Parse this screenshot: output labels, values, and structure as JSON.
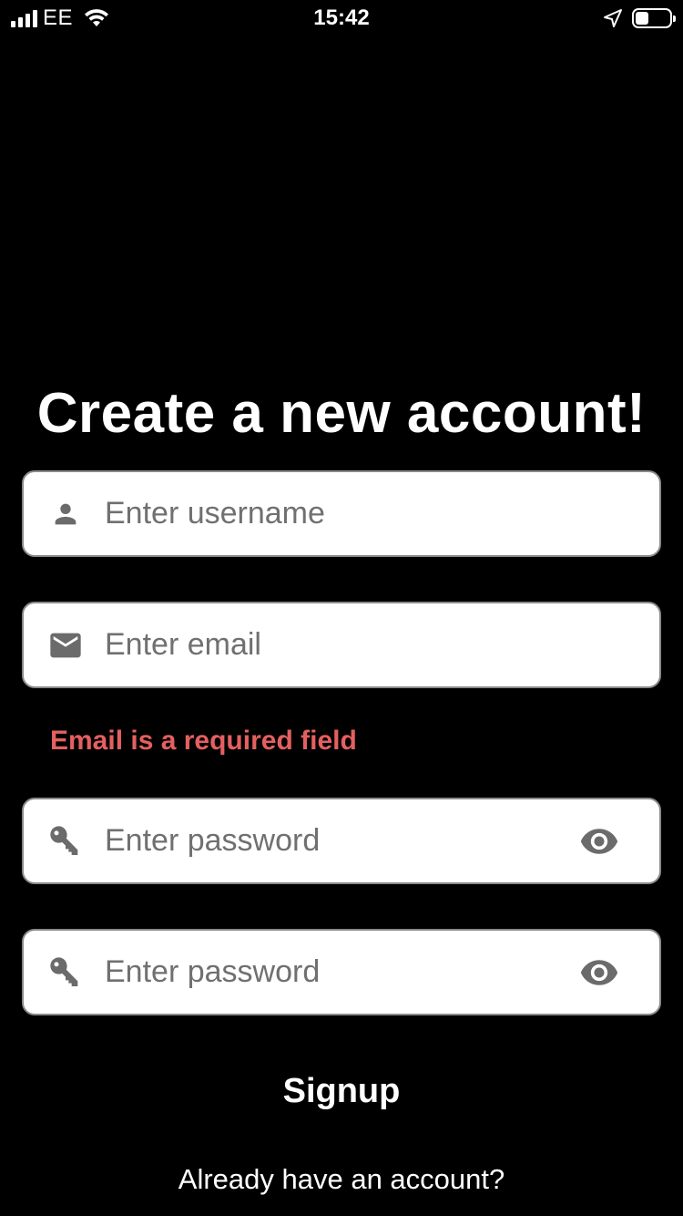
{
  "status_bar": {
    "carrier": "EE",
    "time": "15:42",
    "battery_level": 0.4
  },
  "page": {
    "title": "Create a new account!"
  },
  "form": {
    "username": {
      "placeholder": "Enter username",
      "value": "",
      "icon": "person-icon"
    },
    "email": {
      "placeholder": "Enter email",
      "value": "",
      "icon": "mail-icon"
    },
    "email_error": "Email is a required field",
    "password": {
      "placeholder": "Enter password",
      "value": "",
      "icon": "key-icon",
      "toggle_icon": "eye-icon"
    },
    "confirm_password": {
      "placeholder": "Enter password",
      "value": "",
      "icon": "key-icon",
      "toggle_icon": "eye-icon"
    },
    "signup_label": "Signup",
    "login_link": "Already have an account?"
  },
  "colors": {
    "background": "#000000",
    "error": "#e46060",
    "icon": "#6b6b6b",
    "field_border": "#8a8a8a"
  }
}
